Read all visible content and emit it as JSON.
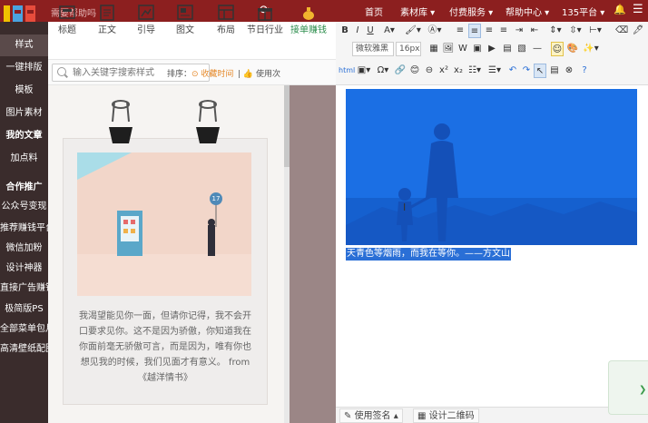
{
  "header": {
    "tip": "需要帮助吗",
    "nav": [
      "首页",
      "素材库",
      "付费服务",
      "帮助中心",
      "135平台"
    ]
  },
  "sidebar": {
    "items": [
      "样式",
      "一键排版",
      "模板",
      "图片素材",
      "我的文章",
      "加点料",
      "合作推广",
      "公众号变现",
      "推荐赚钱平台",
      "微信加粉",
      "设计神器",
      "直接广告赚钱",
      "极简版PS",
      "全部菜单包月",
      "高清壁纸配图"
    ]
  },
  "tabs": [
    "标题",
    "正文",
    "引导",
    "图文",
    "布局",
    "节日行业",
    "接单赚钱"
  ],
  "search": {
    "placeholder": "输入关键字搜索样式",
    "sort_label": "排序：",
    "sort_opt1": "收藏时间",
    "sort_opt2": "使用次"
  },
  "card": {
    "quote": "我渴望能见你一面，但请你记得，我不会开口要求见你。这不是因为骄傲，你知道我在你面前毫无骄傲可言，而是因为，唯有你也想见我的时候，我们见面才有意义。 from《越洋情书》",
    "badge": "17"
  },
  "toolbar": {
    "font": "微软雅黑",
    "size": "16px"
  },
  "editor": {
    "caption": "天青色等烟雨，而我在等你。——方文山"
  },
  "bottom": {
    "btn1": "使用签名",
    "btn2": "设计二维码"
  }
}
